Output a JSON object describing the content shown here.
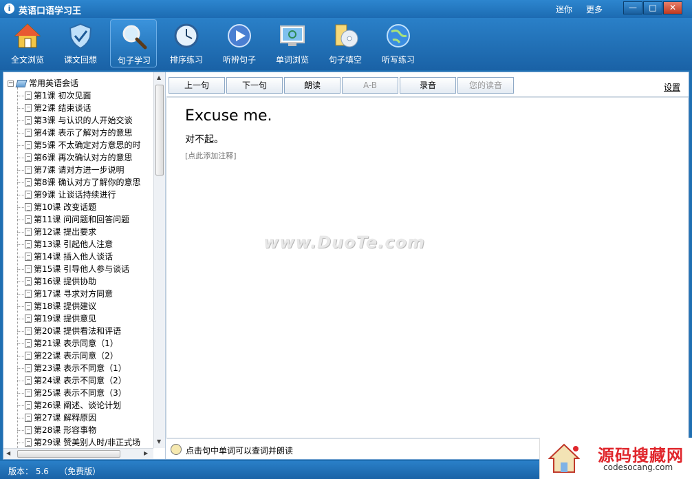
{
  "window": {
    "title": "英语口语学习王",
    "app_icon": "i",
    "links": [
      "迷你",
      "更多"
    ],
    "buttons": {
      "minimize": "—",
      "maximize": "□",
      "close": "✕"
    }
  },
  "toolbar": {
    "items": [
      {
        "label": "全文浏览",
        "icon": "house-icon"
      },
      {
        "label": "课文回想",
        "icon": "shield-icon"
      },
      {
        "label": "句子学习",
        "icon": "magnifier-icon",
        "active": true
      },
      {
        "label": "排序练习",
        "icon": "clock-icon"
      },
      {
        "label": "听辨句子",
        "icon": "play-icon"
      },
      {
        "label": "单词浏览",
        "icon": "monitor-icon"
      },
      {
        "label": "句子填空",
        "icon": "disc-icon"
      },
      {
        "label": "听写练习",
        "icon": "globe-icon"
      }
    ]
  },
  "tree": {
    "expander": "−",
    "root": "常用英语会话",
    "items": [
      "第1课 初次见面",
      "第2课 结束谈话",
      "第3课 与认识的人开始交谈",
      "第4课 表示了解对方的意思",
      "第5课 不太确定对方意思的时",
      "第6课 再次确认对方的意思",
      "第7课 请对方进一步说明",
      "第8课 确认对方了解你的意思",
      "第9课 让谈话持续进行",
      "第10课 改变话题",
      "第11课 问问题和回答问题",
      "第12课 提出要求",
      "第13课 引起他人注意",
      "第14课 插入他人谈话",
      "第15课 引导他人参与谈话",
      "第16课 提供协助",
      "第17课 寻求对方同意",
      "第18课 提供建议",
      "第19课 提供意见",
      "第20课 提供看法和评语",
      "第21课 表示同意（1）",
      "第22课 表示同意（2）",
      "第23课 表示不同意（1）",
      "第24课 表示不同意（2）",
      "第25课 表示不同意（3）",
      "第26课 阐述、谈论计划",
      "第27课 解释原因",
      "第28课 形容事物",
      "第29课 赞美别人时/非正式场"
    ]
  },
  "controls": {
    "buttons": [
      {
        "label": "上一句",
        "enabled": true
      },
      {
        "label": "下一句",
        "enabled": true
      },
      {
        "label": "朗读",
        "enabled": true
      },
      {
        "label": "A-B",
        "enabled": false
      },
      {
        "label": "录音",
        "enabled": true
      },
      {
        "label": "您的读音",
        "enabled": false
      }
    ],
    "settings": "设置"
  },
  "sentence": {
    "english": "Excuse me.",
    "chinese": "对不起。",
    "note_placeholder": "[点此添加注释]"
  },
  "watermark": "www.DuoTe.com",
  "hint": "点击句中单词可以查词并朗读",
  "status": "版本： 5.6    （免费版）",
  "corner_logo": {
    "main": "源码搜藏网",
    "sub": "codesocang.com"
  }
}
